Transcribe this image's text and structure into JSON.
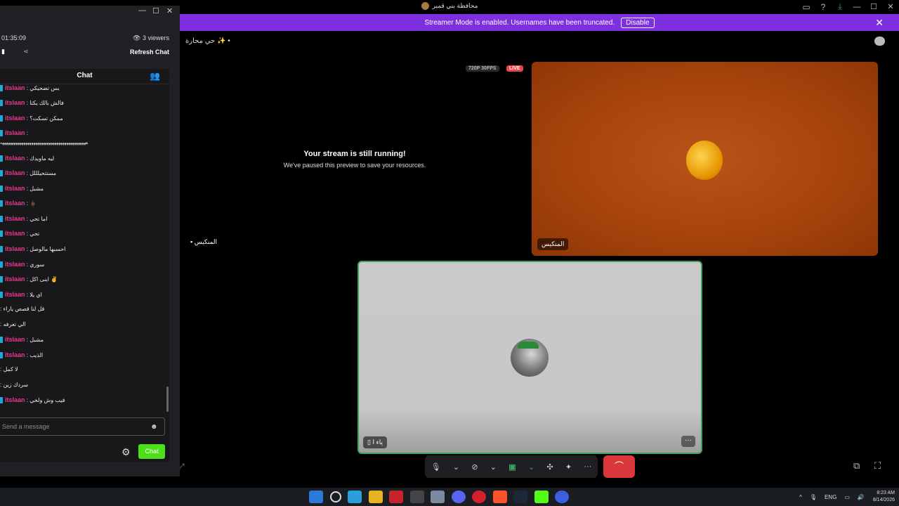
{
  "window": {
    "title": "محافظة بني قمبر",
    "controls": {
      "minimize": "—",
      "maximize": "☐",
      "close": "✕"
    }
  },
  "banner": {
    "message": "Streamer Mode is enabled. Usernames have been truncated.",
    "disable_label": "Disable",
    "close": "✕"
  },
  "channel": {
    "name": "حي محارة ✨ •"
  },
  "stream": {
    "paused_title": "Your stream is still running!",
    "paused_subtitle": "We've paused this preview to save your resources.",
    "quality_badge": "720P 30FPS",
    "live_badge": "LIVE",
    "left_tile_name": "المنكيس",
    "orange_tile_name": "المنكيس",
    "gray_tile_name": "ياء ا",
    "more": "···"
  },
  "call_controls": {
    "more": "···",
    "hangup": "⌒"
  },
  "overlay": {
    "timer": "01:35:09",
    "viewers": "3 viewers",
    "refresh": "Refresh Chat",
    "chat_header": "Chat",
    "input_placeholder": "Send a message",
    "chat_button": "Chat",
    "messages": [
      {
        "user": "itslaan",
        "text": "بس تضحيكي"
      },
      {
        "user": "itslaan",
        "text": "فالش بالك يكتا"
      },
      {
        "user": "itslaan",
        "text": "ممكن تسكت؟"
      },
      {
        "user": "itslaan",
        "text": ""
      },
      {
        "user": "",
        "text": "ههههههههههههههههههههههههههههههههههههههههههههه"
      },
      {
        "user": "itslaan",
        "text": "ليه ماويدك"
      },
      {
        "user": "itslaan",
        "text": "مستتحيلللل"
      },
      {
        "user": "itslaan",
        "text": "مشبل"
      },
      {
        "user": "itslaan",
        "text": "🖕🏿"
      },
      {
        "user": "itslaan",
        "text": "اما تحي"
      },
      {
        "user": "itslaan",
        "text": "تحي"
      },
      {
        "user": "itslaan",
        "text": "احسبها مالوصل"
      },
      {
        "user": "itslaan",
        "text": "سوري"
      },
      {
        "user": "itslaan",
        "text": "ابنى اكل ✌️"
      },
      {
        "user": "itslaan",
        "text": "اي يلا"
      },
      {
        "user": "",
        "text": ": قل لنا قصص ياراء"
      },
      {
        "user": "",
        "text": ": الي تعرفه"
      },
      {
        "user": "itslaan",
        "text": "مشبل"
      },
      {
        "user": "itslaan",
        "text": "الذيب"
      },
      {
        "user": "",
        "text": ": لا كمل"
      },
      {
        "user": "",
        "text": ": سردك زين"
      },
      {
        "user": "itslaan",
        "text": "فيب وش ولخي"
      }
    ]
  },
  "taskbar": {
    "language": "ENG",
    "time": "8:23 AM",
    "date": "8/14/2026",
    "expand": "^"
  }
}
